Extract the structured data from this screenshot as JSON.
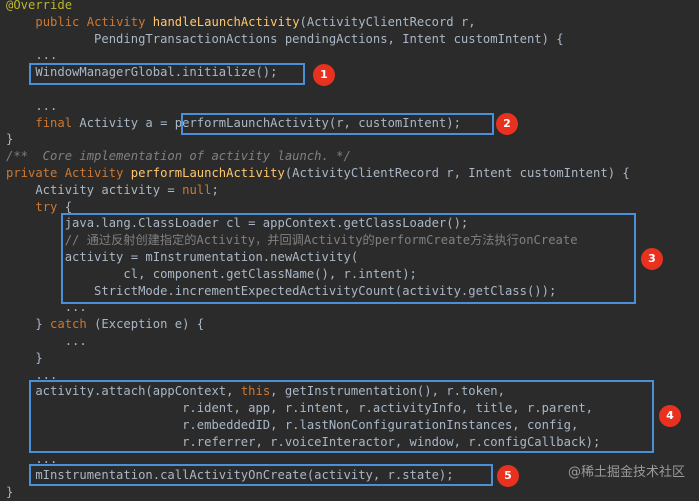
{
  "code": {
    "lines": [
      [
        [
          "@Override",
          "ann"
        ]
      ],
      [
        [
          "    ",
          "plain"
        ],
        [
          "public ",
          "kw"
        ],
        [
          "Activity ",
          "kw"
        ],
        [
          "handleLaunchActivity",
          "fn"
        ],
        [
          "(ActivityClientRecord r,",
          "plain"
        ]
      ],
      [
        [
          "            PendingTransactionActions pendingActions, Intent customIntent) {",
          "plain"
        ]
      ],
      [
        [
          "    ...",
          "plain"
        ]
      ],
      [
        [
          "    WindowManagerGlobal.initialize();",
          "plain"
        ]
      ],
      [
        [
          "",
          "plain"
        ]
      ],
      [
        [
          "    ...",
          "plain"
        ]
      ],
      [
        [
          "    ",
          "plain"
        ],
        [
          "final ",
          "kw"
        ],
        [
          "Activity a = performLaunchActivity(r, customIntent);",
          "plain"
        ]
      ],
      [
        [
          "}",
          "plain"
        ]
      ],
      [
        [
          "/**  Core implementation of activity launch. */",
          "cmt"
        ]
      ],
      [
        [
          "private ",
          "kw"
        ],
        [
          "Activity ",
          "kw"
        ],
        [
          "performLaunchActivity",
          "fn"
        ],
        [
          "(ActivityClientRecord r, Intent customIntent) {",
          "plain"
        ]
      ],
      [
        [
          "    Activity activity = ",
          "plain"
        ],
        [
          "null",
          "kw"
        ],
        [
          ";",
          "plain"
        ]
      ],
      [
        [
          "    ",
          "plain"
        ],
        [
          "try ",
          "kw"
        ],
        [
          "{",
          "plain"
        ]
      ],
      [
        [
          "        java.lang.ClassLoader cl = appContext.getClassLoader();",
          "plain"
        ]
      ],
      [
        [
          "        // 通过反射创建指定的Activity，并回调Activity的performCreate方法执行onCreate",
          "cmt-cn"
        ]
      ],
      [
        [
          "        activity = mInstrumentation.newActivity(",
          "plain"
        ]
      ],
      [
        [
          "                cl, component.getClassName(), r.intent);",
          "plain"
        ]
      ],
      [
        [
          "            StrictMode.incrementExpectedActivityCount(activity.getClass());",
          "plain"
        ]
      ],
      [
        [
          "        ...",
          "plain"
        ]
      ],
      [
        [
          "    } ",
          "plain"
        ],
        [
          "catch ",
          "kw"
        ],
        [
          "(Exception e) {",
          "plain"
        ]
      ],
      [
        [
          "        ...",
          "plain"
        ]
      ],
      [
        [
          "    }",
          "plain"
        ]
      ],
      [
        [
          "    ...",
          "plain"
        ]
      ],
      [
        [
          "    activity.attach(appContext, ",
          "plain"
        ],
        [
          "this",
          "kw"
        ],
        [
          ", getInstrumentation(), r.token,",
          "plain"
        ]
      ],
      [
        [
          "                        r.ident, app, r.intent, r.activityInfo, title, r.parent,",
          "plain"
        ]
      ],
      [
        [
          "                        r.embeddedID, r.lastNonConfigurationInstances, config,",
          "plain"
        ]
      ],
      [
        [
          "                        r.referrer, r.voiceInteractor, window, r.configCallback);",
          "plain"
        ]
      ],
      [
        [
          "    ...",
          "plain"
        ]
      ],
      [
        [
          "    mInstrumentation.callActivityOnCreate(activity, r.state);",
          "plain"
        ]
      ],
      [
        [
          "}",
          "plain"
        ]
      ]
    ]
  },
  "annotations": [
    {
      "label": "1"
    },
    {
      "label": "2"
    },
    {
      "label": "3"
    },
    {
      "label": "4"
    },
    {
      "label": "5"
    }
  ],
  "watermark": "@稀土掘金技术社区",
  "colors": {
    "background": "#2b2b2b",
    "keyword": "#cc7832",
    "annotation": "#bbb529",
    "method": "#ffc66d",
    "comment": "#808080",
    "text": "#a9b7c6",
    "box": "#4a90d9",
    "badge": "#e8321f"
  }
}
